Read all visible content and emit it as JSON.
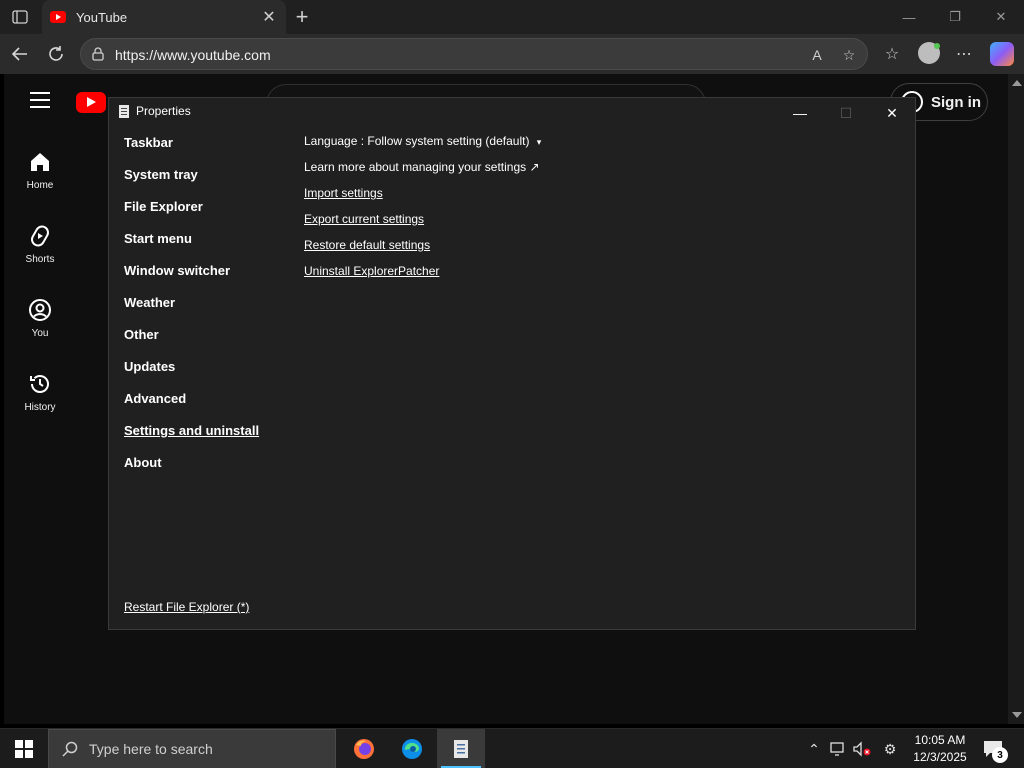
{
  "browser": {
    "tab_title": "YouTube",
    "url": "https://www.youtube.com",
    "reader_icon_label": "A"
  },
  "youtube": {
    "nav": [
      {
        "label": "Home",
        "icon": "home-icon"
      },
      {
        "label": "Shorts",
        "icon": "shorts-icon"
      },
      {
        "label": "You",
        "icon": "account-icon"
      },
      {
        "label": "History",
        "icon": "history-icon"
      }
    ],
    "sign_in": "Sign in"
  },
  "dialog": {
    "title": "Properties",
    "nav": [
      "Taskbar",
      "System tray",
      "File Explorer",
      "Start menu",
      "Window switcher",
      "Weather",
      "Other",
      "Updates",
      "Advanced",
      "Settings and uninstall",
      "About"
    ],
    "active_nav": "Settings and uninstall",
    "language_label": "Language : Follow system setting (default)",
    "language_arrow": "▾",
    "learn_more": "Learn more about managing your settings ↗",
    "links": [
      "Import settings",
      "Export current settings",
      "Restore default settings",
      "Uninstall ExplorerPatcher"
    ],
    "restart": "Restart File Explorer (*)"
  },
  "taskbar": {
    "search_placeholder": "Type here to search",
    "time": "10:05 AM",
    "date": "12/3/2025",
    "notification_count": "3"
  },
  "colors": {
    "youtube_red": "#ff0000",
    "dialog_bg": "#202020",
    "taskbar_bg": "#1c1c1c",
    "accent": "#4cc2ff"
  }
}
